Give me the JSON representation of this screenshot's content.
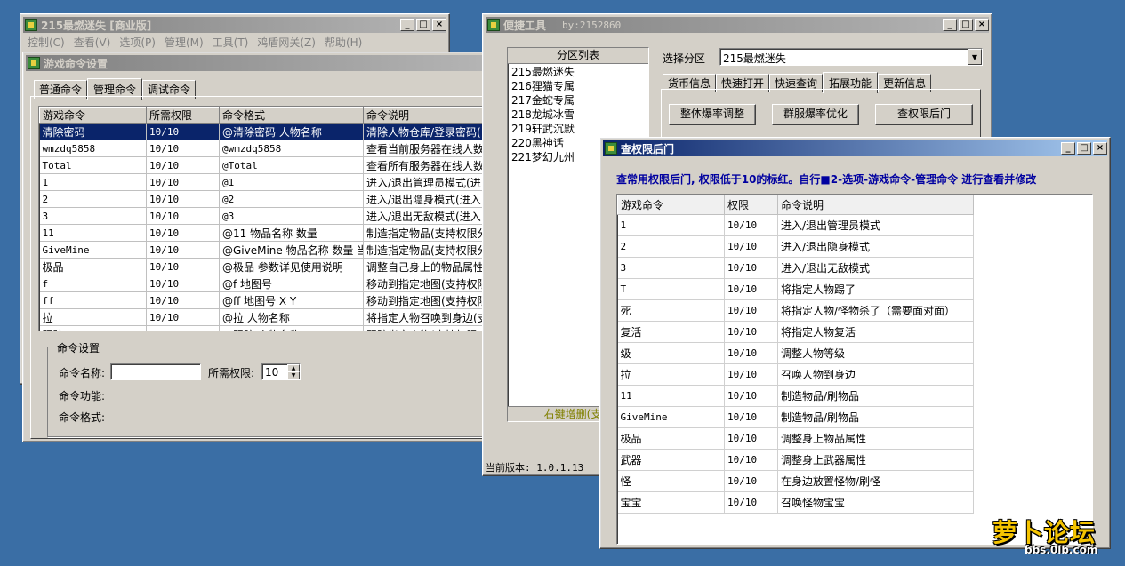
{
  "main_window": {
    "title": "215最燃迷失 [商业版]",
    "menu": [
      "控制(C)",
      "查看(V)",
      "选项(P)",
      "管理(M)",
      "工具(T)",
      "鸡盾网关(Z)",
      "帮助(H)"
    ]
  },
  "cmd_window": {
    "title": "游戏命令设置",
    "tabs": [
      "普通命令",
      "管理命令",
      "调试命令"
    ],
    "selected_tab": "管理命令",
    "columns": [
      "游戏命令",
      "所需权限",
      "命令格式",
      "命令说明"
    ],
    "rows": [
      [
        "清除密码",
        "10/10",
        "@清除密码 人物名称",
        "清除人物仓库/登录密码("
      ],
      [
        "wmzdq5858",
        "10/10",
        "@wmzdq5858",
        "查看当前服务器在线人数"
      ],
      [
        "Total",
        "10/10",
        "@Total",
        "查看所有服务器在线人数"
      ],
      [
        "1",
        "10/10",
        "@1",
        "进入/退出管理员模式(进"
      ],
      [
        "2",
        "10/10",
        "@2",
        "进入/退出隐身模式(进入"
      ],
      [
        "3",
        "10/10",
        "@3",
        "进入/退出无敌模式(进入"
      ],
      [
        "11",
        "10/10",
        "@11 物品名称 数量",
        "制造指定物品(支持权限分"
      ],
      [
        "GiveMine",
        "10/10",
        "@GiveMine 物品名称 数量 当前",
        "制造指定物品(支持权限分"
      ],
      [
        "极品",
        "10/10",
        "@极品 参数详见使用说明",
        "调整自己身上的物品属性"
      ],
      [
        "f",
        "10/10",
        "@f 地图号",
        "移动到指定地图(支持权限"
      ],
      [
        "ff",
        "10/10",
        "@ff 地图号 X Y",
        "移动到指定地图(支持权限"
      ],
      [
        "拉",
        "10/10",
        "@拉 人物名称",
        "将指定人物召唤到身边(支"
      ],
      [
        "跟踪",
        "10/10",
        "@跟踪 人物名称",
        "跟踪指定人物(支持权限"
      ]
    ],
    "group_label": "命令设置",
    "name_label": "命令名称:",
    "name_value": "",
    "perm_label": "所需权限:",
    "perm_value": "10",
    "func_label": "命令功能:",
    "format_label": "命令格式:"
  },
  "tool_window": {
    "title": "便捷工具",
    "byline": "by:2152860",
    "list_header": "分区列表",
    "servers": [
      "215最燃迷失",
      "216狸猫专属",
      "217金蛇专属",
      "218龙城冰雪",
      "219轩武沉默",
      "220黑神话",
      "221梦幻九州"
    ],
    "list_footer": "右键增删(支持",
    "select_label": "选择分区",
    "select_value": "215最燃迷失",
    "tabs": [
      "货币信息",
      "快速打开",
      "快速查询",
      "拓展功能",
      "更新信息"
    ],
    "selected_tab": "拓展功能",
    "buttons": [
      "整体爆率调整",
      "群服爆率优化",
      "查权限后门"
    ],
    "version": "当前版本: 1.0.1.13"
  },
  "backdoor_window": {
    "title": "查权限后门",
    "notice": "查常用权限后门, 权限低于10的标红。自行■2-选项-游戏命令-管理命令 进行查看并修改",
    "columns": [
      "游戏命令",
      "权限",
      "命令说明"
    ],
    "rows": [
      [
        "1",
        "10/10",
        "进入/退出管理员模式"
      ],
      [
        "2",
        "10/10",
        "进入/退出隐身模式"
      ],
      [
        "3",
        "10/10",
        "进入/退出无敌模式"
      ],
      [
        "T",
        "10/10",
        "将指定人物踢了"
      ],
      [
        "死",
        "10/10",
        "将指定人物/怪物杀了（需要面对面）"
      ],
      [
        "复活",
        "10/10",
        "将指定人物复活"
      ],
      [
        "级",
        "10/10",
        "调整人物等级"
      ],
      [
        "拉",
        "10/10",
        "召唤人物到身边"
      ],
      [
        "11",
        "10/10",
        "制造物品/刷物品"
      ],
      [
        "GiveMine",
        "10/10",
        "制造物品/刷物品"
      ],
      [
        "极品",
        "10/10",
        "调整身上物品属性"
      ],
      [
        "武器",
        "10/10",
        "调整身上武器属性"
      ],
      [
        "怪",
        "10/10",
        "在身边放置怪物/刷怪"
      ],
      [
        "宝宝",
        "10/10",
        "召唤怪物宝宝"
      ]
    ]
  },
  "watermark": {
    "name": "萝卜论坛",
    "url": "bbs.0lb.com"
  },
  "colors": {
    "desktop": "#3a6ea5",
    "title_active": "#0a246a",
    "notice_text": "#0000a0",
    "footer_text": "#808000"
  }
}
